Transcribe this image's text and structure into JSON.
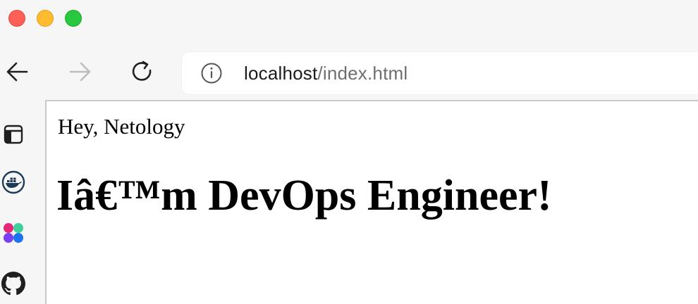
{
  "window": {
    "traffic_lights": [
      {
        "name": "close",
        "color": "#fe5f57"
      },
      {
        "name": "minimize",
        "color": "#febc2e"
      },
      {
        "name": "maximize",
        "color": "#28c840"
      }
    ]
  },
  "toolbar": {
    "back_icon": "arrow-left-icon",
    "forward_icon": "arrow-right-icon",
    "forward_enabled": false,
    "reload_icon": "reload-icon",
    "address": {
      "info_icon": "info-icon",
      "host": "localhost",
      "path": "/index.html"
    }
  },
  "sidebar": {
    "items": [
      {
        "icon": "sidebar-panel-icon"
      },
      {
        "icon": "docker-icon"
      },
      {
        "icon": "apps-icon"
      },
      {
        "icon": "github-icon"
      }
    ]
  },
  "page": {
    "greeting": "Hey, Netology",
    "headline": "Iâ€™m DevOps Engineer!"
  }
}
